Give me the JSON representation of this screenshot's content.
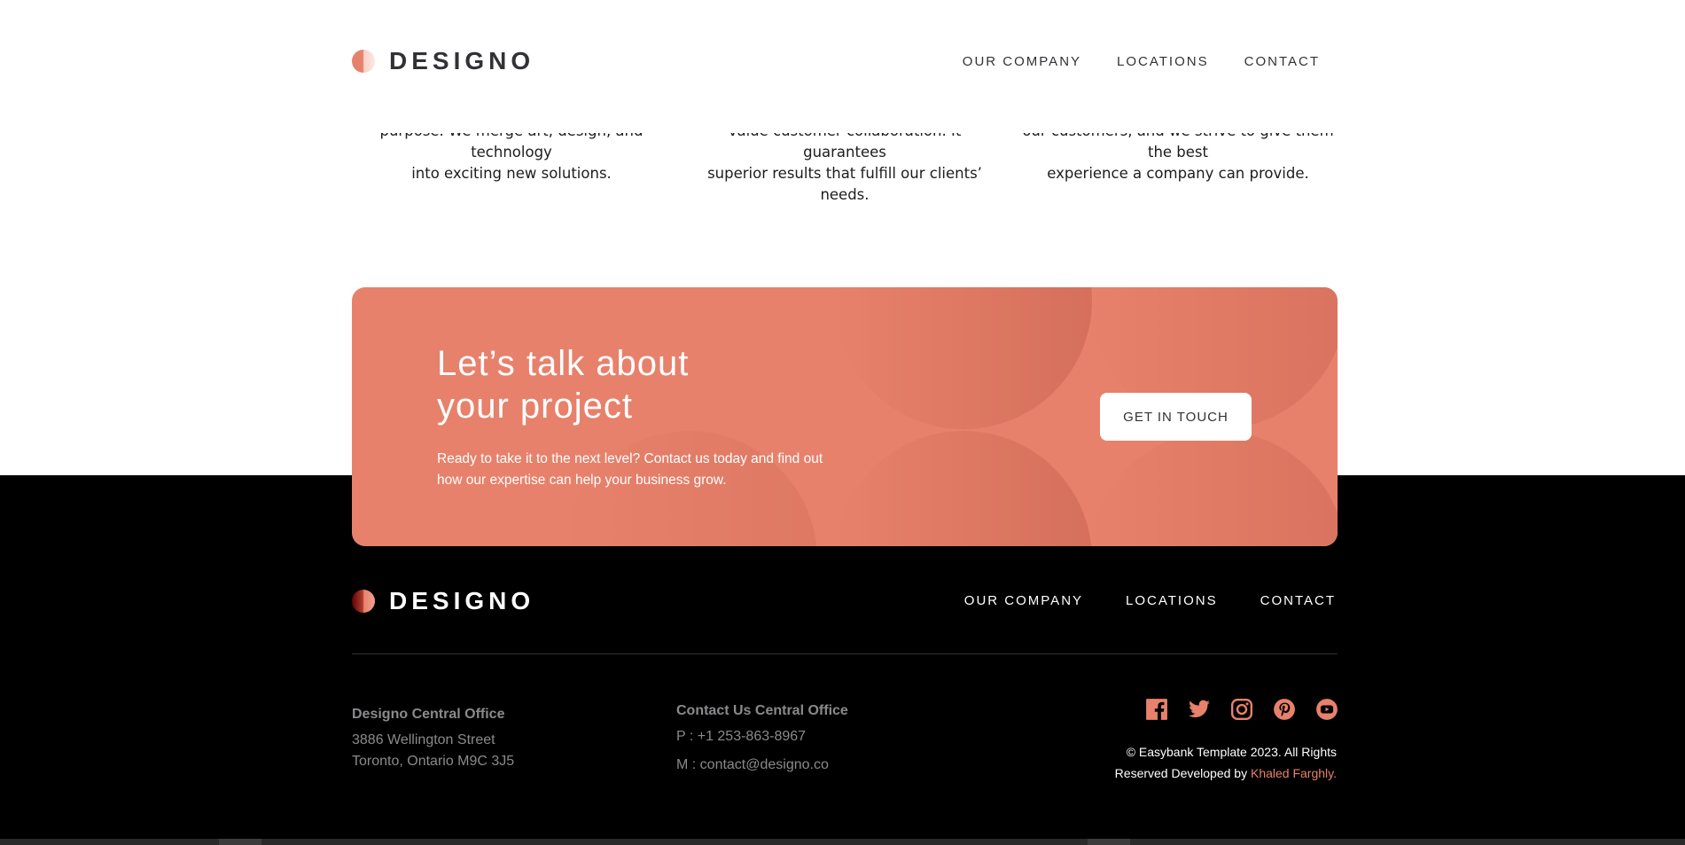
{
  "header": {
    "logo_text": "DESIGNO",
    "nav": [
      "OUR COMPANY",
      "LOCATIONS",
      "CONTACT"
    ]
  },
  "values": [
    {
      "line1": "purpose. We merge art, design, and technology",
      "line2": "into exciting new solutions."
    },
    {
      "line1": "value customer collaboration. It guarantees",
      "line2": "superior results that fulfill our clients’ needs."
    },
    {
      "line1": "our customers, and we strive to give them the best",
      "line2": "experience a company can provide."
    }
  ],
  "cta": {
    "title_line1": "Let’s talk about",
    "title_line2": "your project",
    "desc_line1": "Ready to take it to the next level? Contact us today and find out",
    "desc_line2": "how our expertise can help your business grow.",
    "button_label": "GET IN TOUCH"
  },
  "footer": {
    "logo_text": "DESIGNO",
    "nav": [
      "OUR COMPANY",
      "LOCATIONS",
      "CONTACT"
    ],
    "office1": {
      "title": "Designo Central Office",
      "line1": "3886 Wellington Street",
      "line2": "Toronto, Ontario M9C 3J5"
    },
    "office2": {
      "title": "Contact Us Central Office",
      "phone": "P : +1 253-863-8967",
      "email": "M : contact@designo.co"
    },
    "socials": [
      "facebook-icon",
      "twitter-icon",
      "instagram-icon",
      "pinterest-icon",
      "youtube-icon"
    ],
    "copyright_line1": "© Easybank Template 2023. All Rights",
    "copyright_line2": "Reserved Developed by ",
    "author": "Khaled Farghly."
  },
  "colors": {
    "accent": "#e7816b",
    "dark": "#333136",
    "footer_bg": "#000000",
    "muted": "#8a8a8d"
  }
}
